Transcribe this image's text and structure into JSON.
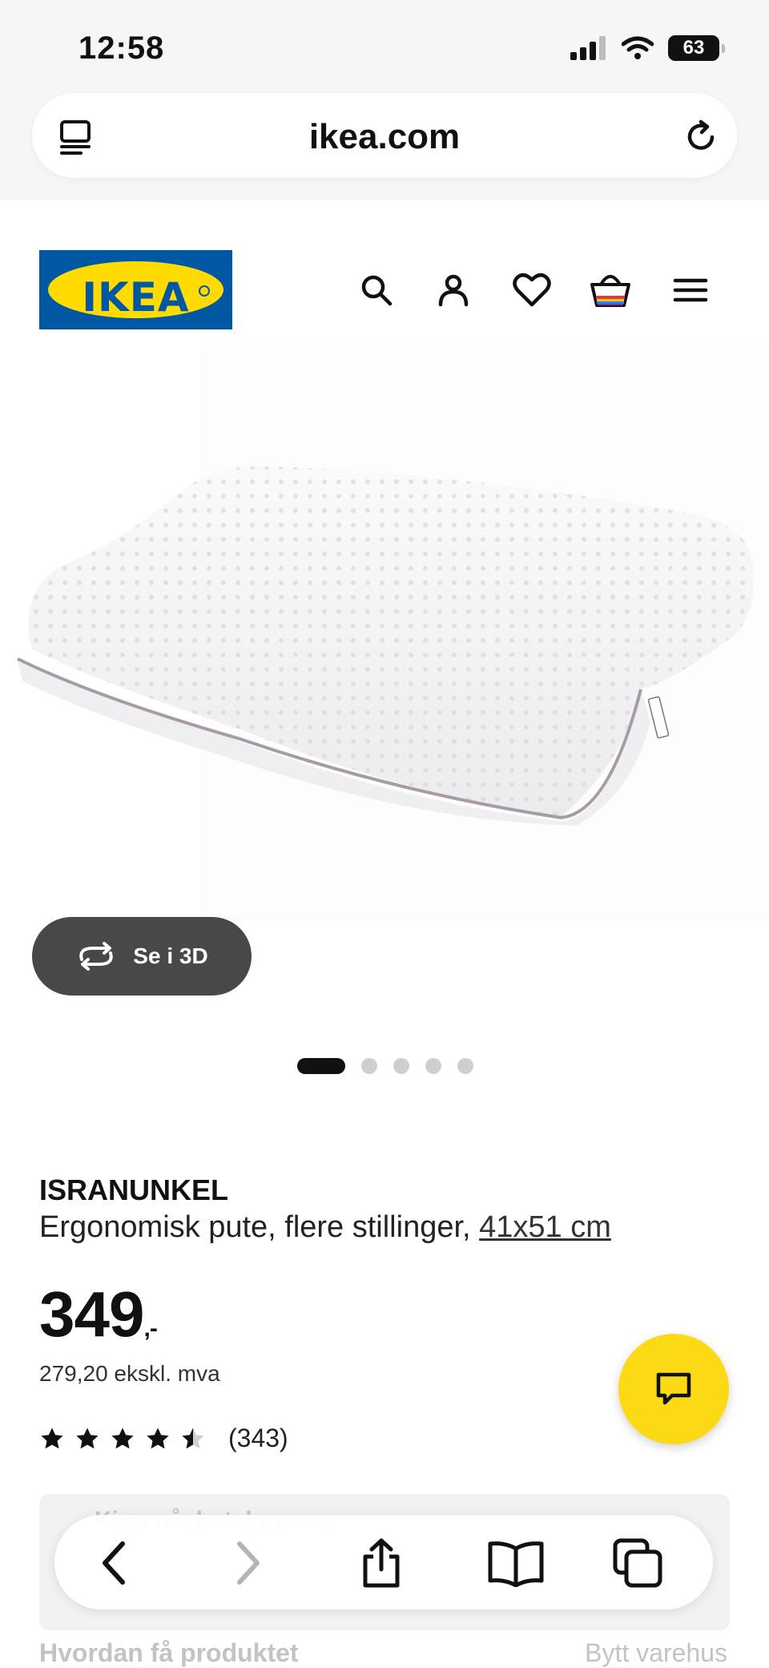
{
  "status_bar": {
    "time": "12:58",
    "battery": "63"
  },
  "browser": {
    "url": "ikea.com"
  },
  "brand": {
    "logo_text": "IKEA",
    "blue": "#0058a3",
    "yellow": "#ffdb00"
  },
  "header": {
    "icons": [
      "search-icon",
      "account-icon",
      "heart-icon",
      "shopping-bag-icon",
      "menu-icon"
    ]
  },
  "gallery": {
    "view_3d_label": "Se i 3D",
    "image_count": 5,
    "active_index": 0
  },
  "product": {
    "name": "ISRANUNKEL",
    "description": "Ergonomisk pute, flere stillinger,",
    "size": "41x51 cm",
    "price": "349",
    "price_suffix": ",-",
    "price_ex_vat": "279,20 ekskl. mva",
    "rating": 4.5,
    "review_count": "(343)"
  },
  "promo": {
    "text": "Kjøp nå, betal senere"
  },
  "delivery": {
    "heading": "Hvordan få produktet",
    "change_store": "Bytt varehus"
  },
  "toolbar": {
    "icons": [
      "back-icon",
      "forward-icon",
      "share-icon",
      "bookmarks-icon",
      "tabs-icon"
    ]
  },
  "colors": {
    "chat_button": "#fbd914",
    "threed_button": "#484848"
  }
}
